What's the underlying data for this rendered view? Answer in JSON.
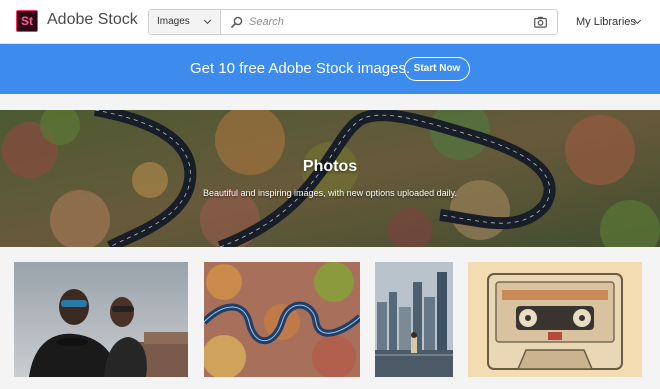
{
  "header": {
    "logo_mark": "St",
    "logo_text": "Adobe Stock",
    "search_type": "Images",
    "search_placeholder": "Search",
    "my_libraries": "My Libraries"
  },
  "promo": {
    "text": "Get 10 free Adobe Stock images.",
    "button": "Start Now"
  },
  "hero": {
    "title": "Photos",
    "subtitle": "Beautiful and inspiring images, with new options uploaded daily."
  },
  "colors": {
    "promo_bg": "#3d8bec",
    "logo_accent": "#ff2e6a"
  }
}
